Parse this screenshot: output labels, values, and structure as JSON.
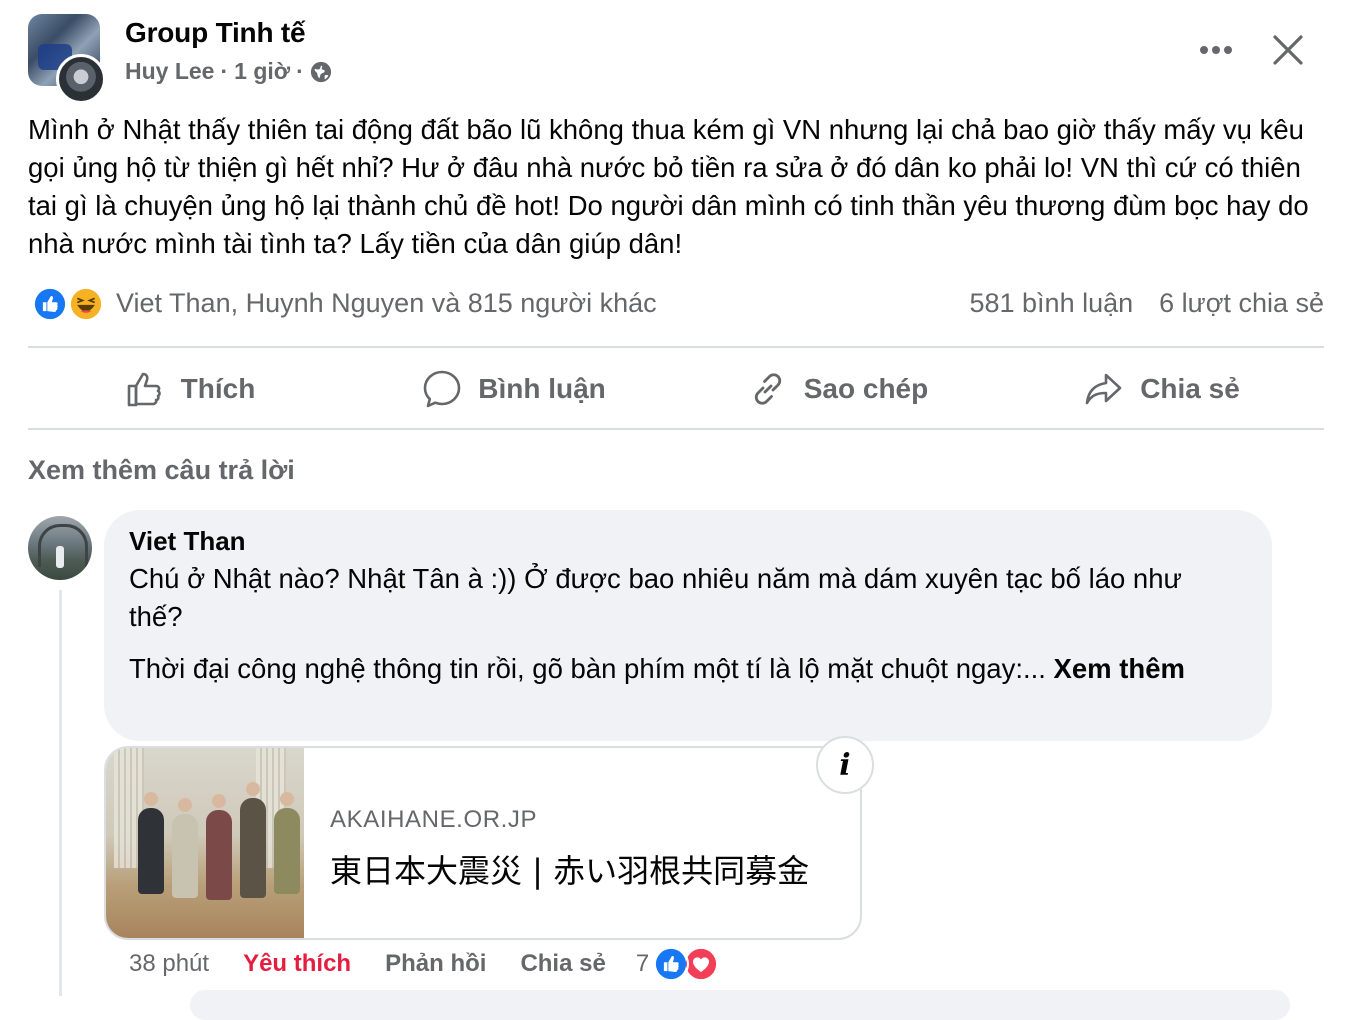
{
  "header": {
    "group_name": "Group Tinh tế",
    "author": "Huy Lee",
    "separator": "·",
    "time": "1 giờ",
    "privacy_icon": "globe-icon",
    "more_icon": "more-horizontal-icon",
    "close_icon": "close-icon"
  },
  "post": {
    "text": "Mình ở Nhật thấy thiên tai động đất bão lũ không thua kém gì VN nhưng lại chả bao giờ thấy mấy vụ kêu gọi ủng hộ từ thiện gì hết nhỉ? Hư ở đâu nhà nước bỏ tiền ra sửa ở đó dân ko phải lo! VN thì cứ có thiên tai gì là chuyện ủng hộ lại thành chủ đề hot! Do người dân mình có tinh thần yêu thương đùm bọc hay do nhà nước mình tài tình ta? Lấy tiền của dân giúp dân!"
  },
  "reactions": {
    "icons": [
      "like-reaction-icon",
      "haha-reaction-icon"
    ],
    "names": "Viet Than, Huynh Nguyen và 815 người khác",
    "comments": "581 bình luận",
    "shares": "6 lượt chia sẻ"
  },
  "actions": {
    "like": "Thích",
    "comment": "Bình luận",
    "copy": "Sao chép",
    "share": "Chia sẻ"
  },
  "see_more_replies": "Xem thêm câu trả lời",
  "comment": {
    "author": "Viet Than",
    "paragraph1": "Chú ở Nhật nào? Nhật Tân à :)) Ở được bao nhiêu năm mà dám xuyên tạc bố láo như thế?",
    "paragraph2": "Thời đại công nghệ thông tin rồi, gõ bàn phím một tí là lộ mặt chuột ngay:...",
    "see_more": "Xem thêm",
    "link": {
      "domain": "AKAIHANE.OR.JP",
      "title": "東日本大震災 | 赤い羽根共同募金",
      "info_icon": "i"
    },
    "time": "38 phút",
    "like_label": "Yêu thích",
    "reply_label": "Phản hồi",
    "share_label": "Chia sẻ",
    "reaction_count": "7",
    "reaction_icons": [
      "like-reaction-icon",
      "love-reaction-icon"
    ]
  },
  "colors": {
    "secondary_text": "#65676b",
    "like_blue": "#1877f2",
    "love_red": "#f33e58",
    "active_like": "#e41e3f",
    "bubble_bg": "#f0f2f5",
    "divider": "#dadde1"
  }
}
